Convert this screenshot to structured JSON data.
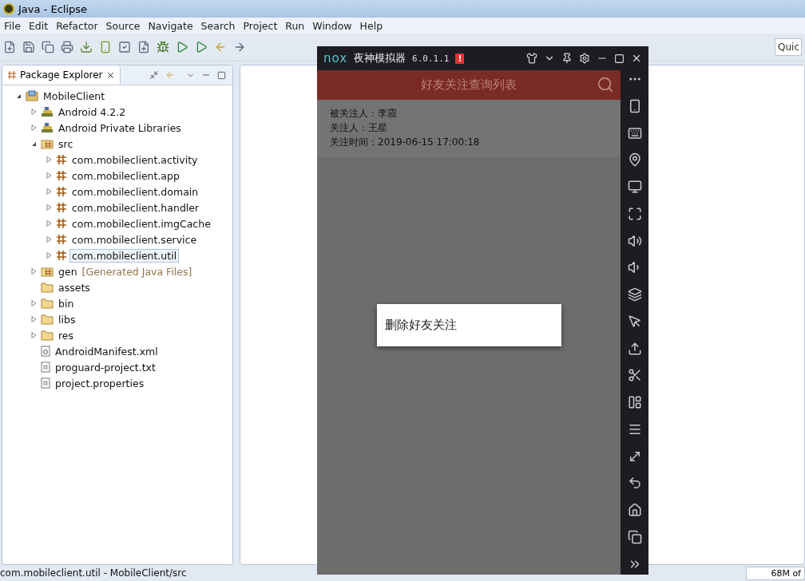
{
  "window": {
    "title": "Java - Eclipse"
  },
  "menu": [
    "File",
    "Edit",
    "Refactor",
    "Source",
    "Navigate",
    "Search",
    "Project",
    "Run",
    "Window",
    "Help"
  ],
  "quick_access": {
    "placeholder": "Quic"
  },
  "package_explorer": {
    "tab": {
      "label": "Package Explorer",
      "selected": true
    },
    "tree": [
      {
        "label": "MobileClient",
        "kind": "project",
        "expanded": true,
        "selected": false,
        "children": [
          {
            "label": "Android 4.2.2",
            "kind": "library",
            "expanded": false,
            "selected": false
          },
          {
            "label": "Android Private Libraries",
            "kind": "library",
            "expanded": false,
            "selected": false
          },
          {
            "label": "src",
            "kind": "source-folder",
            "expanded": true,
            "selected": false,
            "children": [
              {
                "label": "com.mobileclient.activity",
                "kind": "package",
                "expanded": false,
                "selected": false
              },
              {
                "label": "com.mobileclient.app",
                "kind": "package",
                "expanded": false,
                "selected": false
              },
              {
                "label": "com.mobileclient.domain",
                "kind": "package",
                "expanded": false,
                "selected": false
              },
              {
                "label": "com.mobileclient.handler",
                "kind": "package",
                "expanded": false,
                "selected": false
              },
              {
                "label": "com.mobileclient.imgCache",
                "kind": "package",
                "expanded": false,
                "selected": false
              },
              {
                "label": "com.mobileclient.service",
                "kind": "package",
                "expanded": false,
                "selected": false
              },
              {
                "label": "com.mobileclient.util",
                "kind": "package",
                "expanded": false,
                "selected": true
              }
            ]
          },
          {
            "label": "gen",
            "decoration": "[Generated Java Files]",
            "kind": "source-folder",
            "expanded": false,
            "selected": false
          },
          {
            "label": "assets",
            "kind": "folder",
            "selected": false
          },
          {
            "label": "bin",
            "kind": "folder",
            "expanded": false,
            "selected": false
          },
          {
            "label": "libs",
            "kind": "folder",
            "expanded": false,
            "selected": false
          },
          {
            "label": "res",
            "kind": "folder",
            "expanded": false,
            "selected": false
          },
          {
            "label": "AndroidManifest.xml",
            "kind": "xml",
            "selected": false
          },
          {
            "label": "proguard-project.txt",
            "kind": "file",
            "selected": false
          },
          {
            "label": "project.properties",
            "kind": "file",
            "selected": false
          }
        ]
      }
    ]
  },
  "status_bar": {
    "text": "com.mobileclient.util - MobileClient/src",
    "memory": "68M of"
  },
  "emulator": {
    "logo": "nox",
    "title": "夜神模拟器",
    "version": "6.0.1.1",
    "alert": "!",
    "app": {
      "title": "好友关注查询列表",
      "record": [
        "被关注人：李霞",
        "关注人：王星",
        "关注时间：2019-06-15 17:00:18"
      ],
      "dialog": {
        "option": "删除好友关注"
      }
    }
  }
}
